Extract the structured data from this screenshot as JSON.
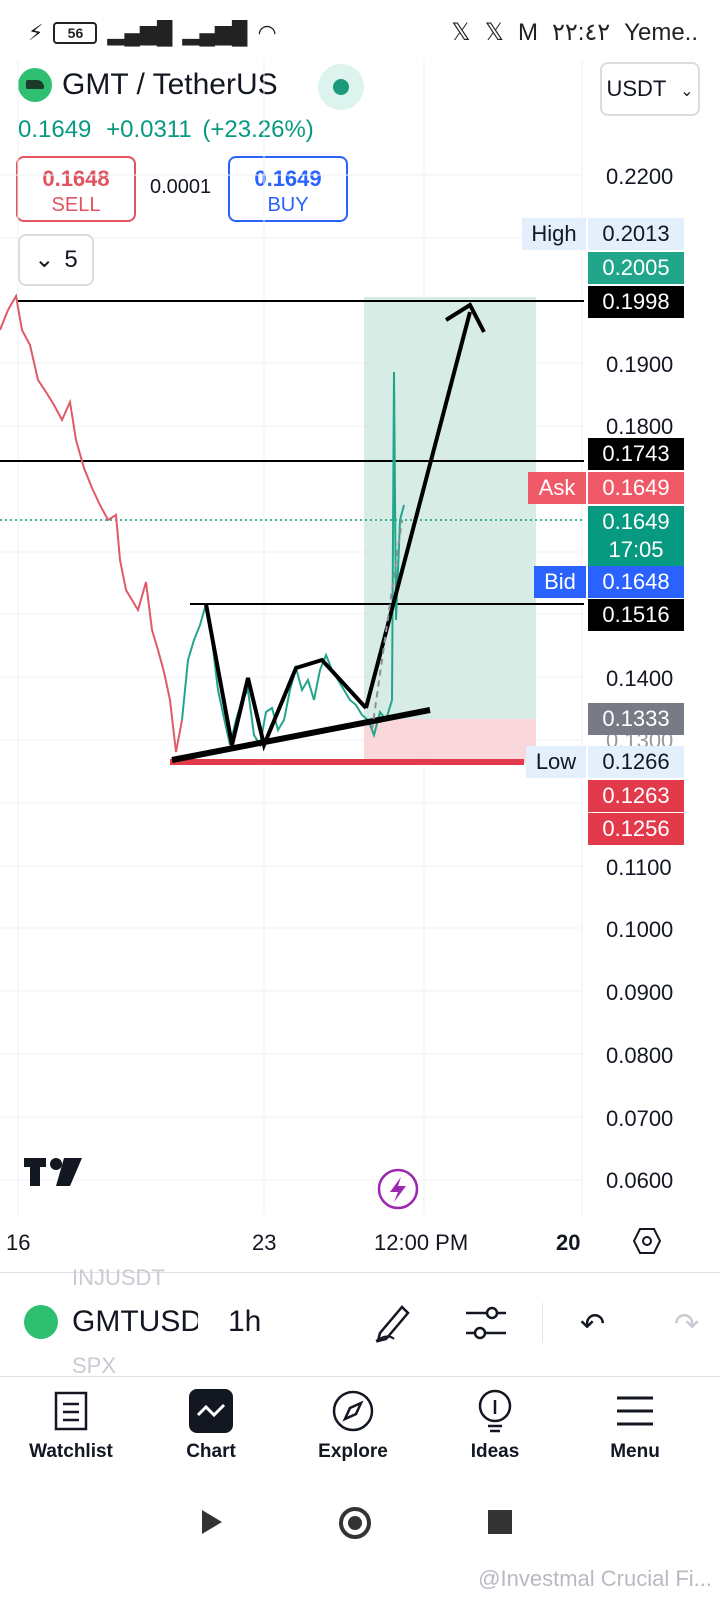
{
  "status_bar": {
    "battery": "56",
    "time": "٢٢:٤٢",
    "carrier": "Yeme..",
    "notification_icons": [
      "x-icon",
      "x-icon",
      "gmail-icon"
    ]
  },
  "header": {
    "symbol": "GMT / TetherUS",
    "last_price": "0.1649",
    "change": "+0.0311",
    "change_pct": "(+23.26%)",
    "currency": "USDT"
  },
  "trade": {
    "sell_price": "0.1648",
    "sell_label": "SELL",
    "spread": "0.0001",
    "buy_price": "0.1649",
    "buy_label": "BUY"
  },
  "collapse_count": "5",
  "price_axis": {
    "ticks": [
      "0.2200",
      "0.1900",
      "0.1800",
      "0.1400",
      "0.1300",
      "0.1100",
      "0.1000",
      "0.0900",
      "0.0800",
      "0.0700",
      "0.0600"
    ],
    "high_label": "High",
    "high_value": "0.2013",
    "tag_0": "0.2005",
    "line_1998": "0.1998",
    "line_1743": "0.1743",
    "ask_label": "Ask",
    "ask_value": "0.1649",
    "last_value": "0.1649",
    "countdown": "17:05",
    "bid_label": "Bid",
    "bid_value": "0.1648",
    "line_1516": "0.1516",
    "tag_1333": "0.1333",
    "low_label": "Low",
    "low_value": "0.1266",
    "tag_1263": "0.1263",
    "tag_1256": "0.1256"
  },
  "time_axis": [
    "16",
    "23",
    "12:00 PM",
    "20"
  ],
  "toolbar": {
    "ghost_top": "INJUSDT",
    "symbol": "GMTUSD",
    "interval": "1h",
    "ghost_bottom": "SPX"
  },
  "nav": {
    "items": [
      {
        "label": "Watchlist"
      },
      {
        "label": "Chart"
      },
      {
        "label": "Explore"
      },
      {
        "label": "Ideas"
      },
      {
        "label": "Menu"
      }
    ]
  },
  "watermark": "@Investmal Crucial Fi...",
  "colors": {
    "up": "#089981",
    "down": "#f23645",
    "accent": "#2962ff",
    "target_zone": "#cfe9e0",
    "stop_zone": "#f8d3d6"
  }
}
